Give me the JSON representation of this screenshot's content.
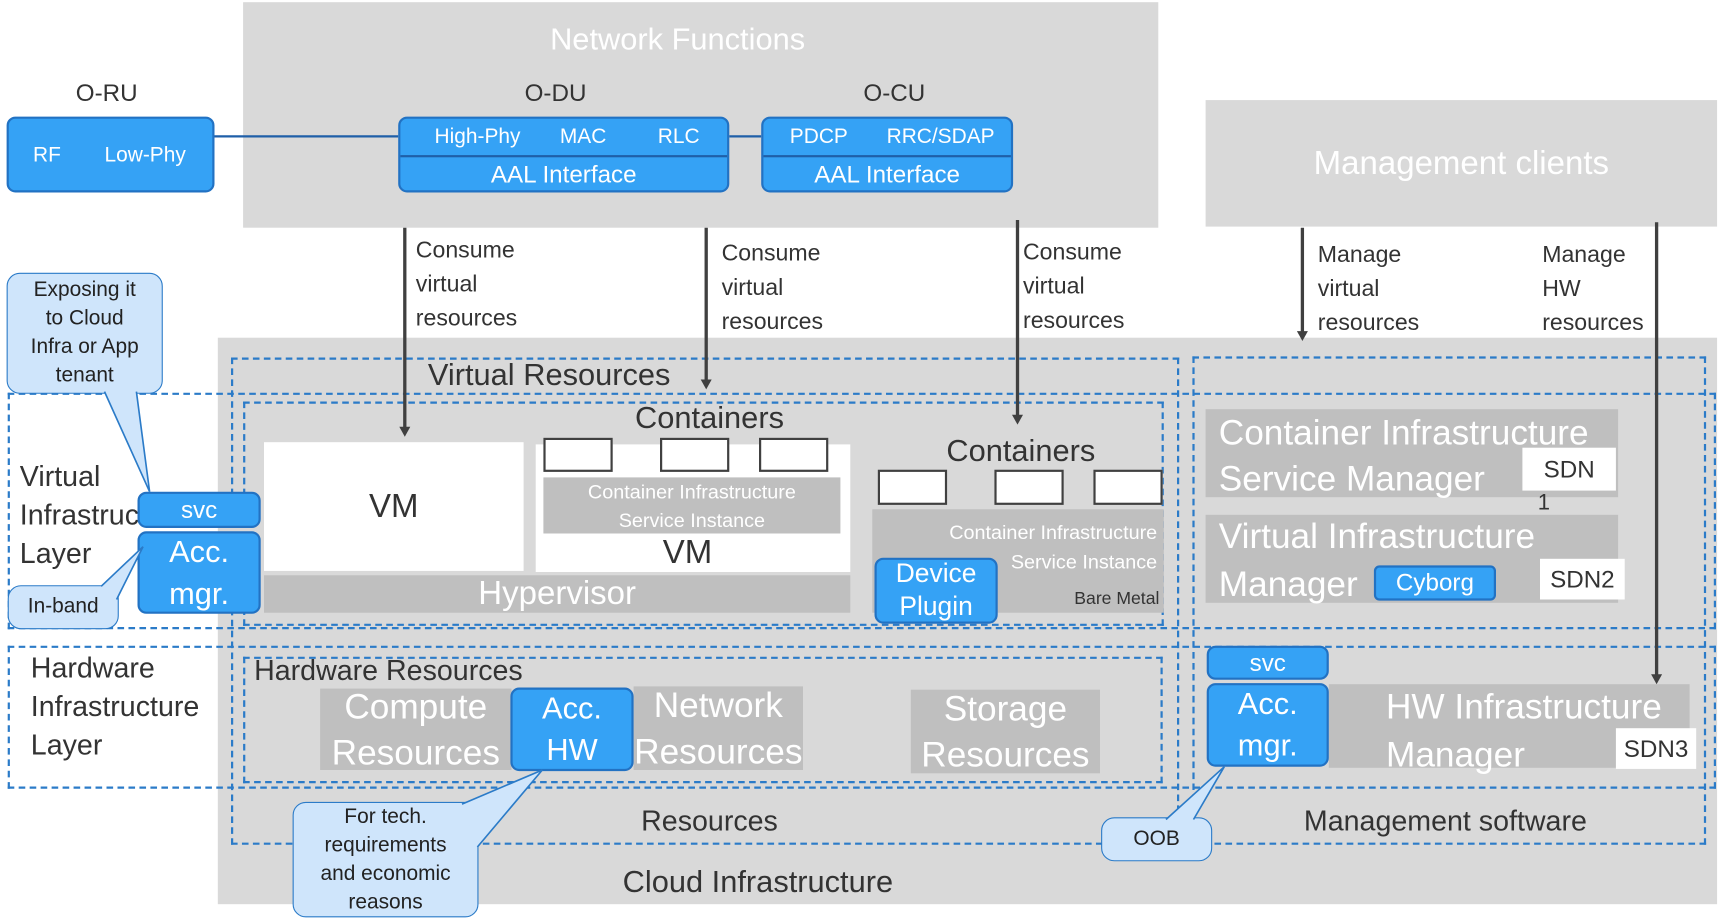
{
  "colors": {
    "accent_blue": "#35a2f5",
    "dashed_border": "#2b7bc8",
    "panel_gray": "#d9d9d9",
    "box_gray": "#bfbfbf",
    "arrow": "#404040"
  },
  "network_functions": {
    "title": "Network Functions",
    "oru": {
      "label": "O-RU",
      "items": [
        "RF",
        "Low-Phy"
      ]
    },
    "odu": {
      "label": "O-DU",
      "items": [
        "High-Phy",
        "MAC",
        "RLC"
      ],
      "aal": "AAL Interface"
    },
    "ocu": {
      "label": "O-CU",
      "items": [
        "PDCP",
        "RRC/SDAP"
      ],
      "aal": "AAL Interface"
    }
  },
  "management_clients": {
    "title": "Management clients"
  },
  "arrow_labels": {
    "consume": "Consume\nvirtual\nresources",
    "manage_virtual": "Manage\nvirtual\nresources",
    "manage_hw": "Manage\nHW\nresources"
  },
  "layers": {
    "virtual": "Virtual\nInfrastructure\nLayer",
    "hardware": "Hardware\nInfrastructure\nLayer"
  },
  "cloud": {
    "title": "Cloud Infrastructure",
    "resources": "Resources",
    "management_software": "Management software",
    "virtual_resources": "Virtual Resources",
    "containers": "Containers",
    "vm": "VM",
    "cisi": "Container Infrastructure\nService Instance",
    "hypervisor": "Hypervisor",
    "bare_metal": "Bare Metal",
    "device_plugin": "Device\nPlugin",
    "hardware_resources": "Hardware Resources",
    "compute": "Compute\nResources",
    "acc_hw": "Acc.\nHW",
    "network": "Network\nResources",
    "storage": "Storage\nResources",
    "svc": "svc",
    "acc_mgr": "Acc.\nmgr.",
    "cism": "Container Infrastructure\nService Manager",
    "sdn1": "SDN",
    "sdn1_suffix": "1",
    "vim": "Virtual Infrastructure\nManager",
    "cyborg": "Cyborg",
    "sdn2": "SDN2",
    "hwim": "HW Infrastructure\nManager",
    "sdn3": "SDN3"
  },
  "callouts": {
    "exposing": "Exposing it\nto Cloud\nInfra or App\ntenant",
    "inband": "In-band",
    "tech": "For tech.\nrequirements\nand economic\nreasons",
    "oob": "OOB"
  }
}
